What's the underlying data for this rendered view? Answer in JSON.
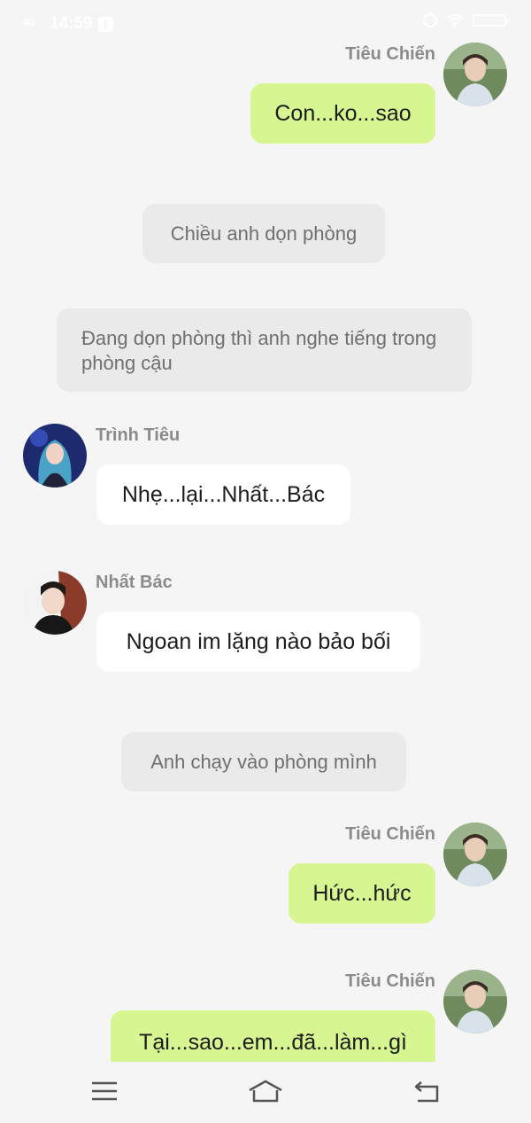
{
  "status_bar": {
    "network": "4G",
    "time": "14:59",
    "app_icon": "facebook-icon",
    "right_icons": [
      "alarm-icon",
      "wifi-icon",
      "battery-icon"
    ]
  },
  "messages": [
    {
      "type": "chat",
      "side": "right",
      "sender": "Tiêu Chiến",
      "text": "Con...ko...sao",
      "avatar": "tieu-chien-avatar"
    },
    {
      "type": "narration",
      "text": "Chiều anh dọn phòng"
    },
    {
      "type": "narration",
      "text": "Đang dọn phòng thì anh nghe tiếng trong phòng cậu"
    },
    {
      "type": "chat",
      "side": "left",
      "sender": "Trình Tiêu",
      "text": "Nhẹ...lại...Nhất...Bác",
      "avatar": "trinh-tieu-avatar"
    },
    {
      "type": "chat",
      "side": "left",
      "sender": "Nhất Bác",
      "text": "Ngoan im lặng nào bảo bối",
      "avatar": "nhat-bac-avatar"
    },
    {
      "type": "narration",
      "text": "Anh chạy vào phòng mình"
    },
    {
      "type": "chat",
      "side": "right",
      "sender": "Tiêu Chiến",
      "text": "Hức...hức",
      "avatar": "tieu-chien-avatar"
    },
    {
      "type": "chat",
      "side": "right",
      "sender": "Tiêu Chiến",
      "text": "Tại...sao...em...đã...làm...gì",
      "avatar": "tieu-chien-avatar"
    }
  ],
  "nav_bar": {
    "buttons": [
      "menu-icon",
      "home-icon",
      "back-icon"
    ]
  },
  "colors": {
    "background": "#f5f5f5",
    "right_bubble": "#d7f691",
    "left_bubble": "#ffffff",
    "narration_bubble": "#eaeaea",
    "name_text": "#8b8b8b"
  }
}
